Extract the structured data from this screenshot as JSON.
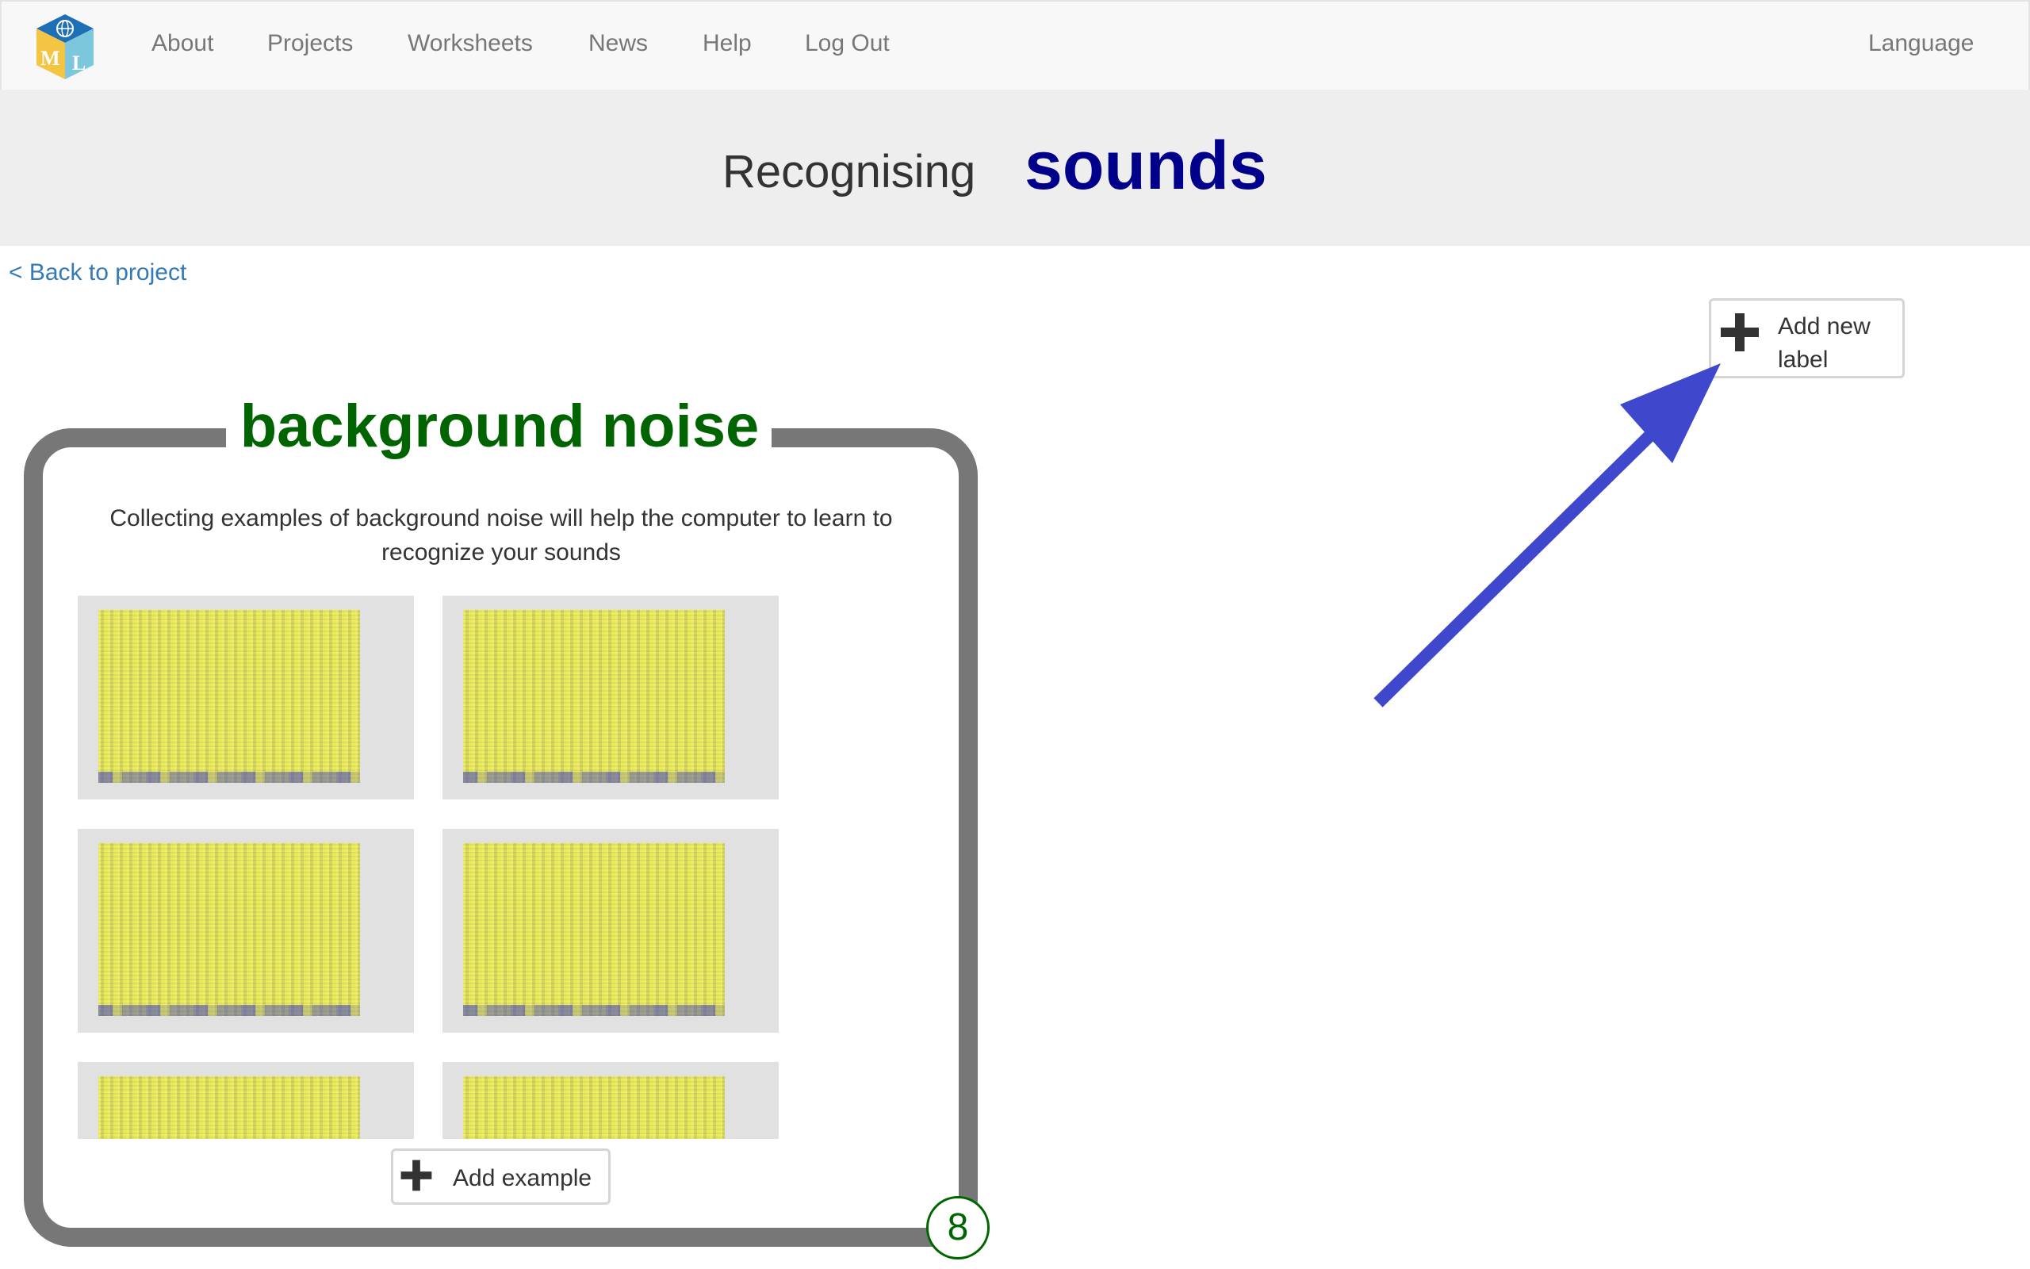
{
  "navbar": {
    "logo_letters": "ML",
    "items": [
      {
        "label": "About"
      },
      {
        "label": "Projects"
      },
      {
        "label": "Worksheets"
      },
      {
        "label": "News"
      },
      {
        "label": "Help"
      },
      {
        "label": "Log Out"
      }
    ],
    "language_label": "Language"
  },
  "header": {
    "prefix": "Recognising",
    "project_type": "sounds"
  },
  "back_link": "< Back to project",
  "add_label_button": {
    "icon": "plus-icon",
    "label": "Add new label"
  },
  "annotation": {
    "icon": "arrow-icon",
    "color": "#3f48cc"
  },
  "label_card": {
    "title": "background noise",
    "description": "Collecting examples of background noise will help the computer to learn to recognize your sounds",
    "example_type": "spectrogram",
    "add_example_label": "Add example",
    "count": "8"
  },
  "colors": {
    "project_type": "#00008b",
    "label_title": "#006400",
    "link": "#337ab7",
    "card_border": "#777777"
  }
}
